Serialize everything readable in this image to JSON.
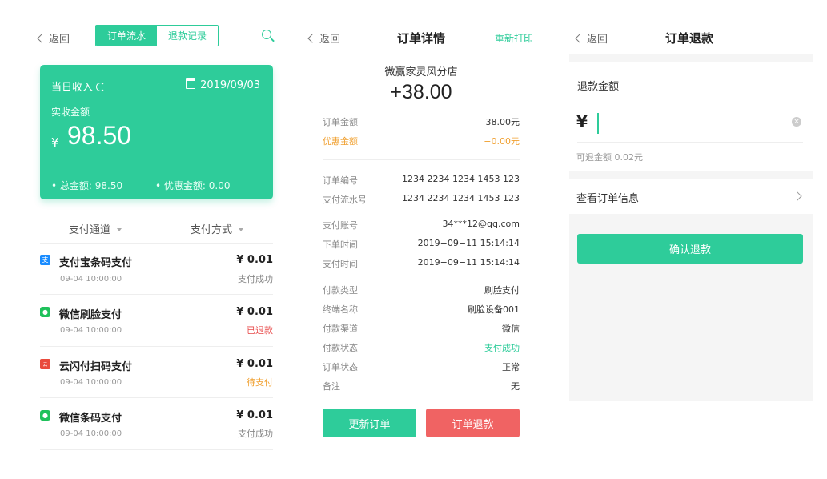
{
  "screen1": {
    "back_label": "返回",
    "tabs": [
      {
        "label": "订单流水",
        "active": true
      },
      {
        "label": "退款记录",
        "active": false
      }
    ],
    "card": {
      "title": "当日收入",
      "date": "2019/09/03",
      "amount_label": "实收金额",
      "currency": "¥",
      "amount": "98.50",
      "total_label": "• 总金额: 98.50",
      "discount_label": "• 优惠金额: 0.00"
    },
    "filters": [
      "支付通道",
      "支付方式"
    ],
    "rows": [
      {
        "name": "支付宝条码支付",
        "time": "09-04 10:00:00",
        "amount": "¥ 0.01",
        "status": "支付成功",
        "icon": "alipay-icon",
        "status_color": "#888888"
      },
      {
        "name": "微信刷脸支付",
        "time": "09-04 10:00:00",
        "amount": "¥ 0.01",
        "status": "已退款",
        "icon": "wechat-icon",
        "status_color": "#e84b4b"
      },
      {
        "name": "云闪付扫码支付",
        "time": "09-04 10:00:00",
        "amount": "¥ 0.01",
        "status": "待支付",
        "icon": "unionpay-icon",
        "status_color": "#f0a030"
      },
      {
        "name": "微信条码支付",
        "time": "09-04 10:00:00",
        "amount": "¥ 0.01",
        "status": "支付成功",
        "icon": "wechat-icon",
        "status_color": "#888888"
      }
    ]
  },
  "screen2": {
    "back_label": "返回",
    "title": "订单详情",
    "reprint_label": "重新打印",
    "store": "微赢家灵风分店",
    "amount": "+38.00",
    "fields": [
      {
        "k": "订单金额",
        "v": "38.00元"
      },
      {
        "k": "优惠金额",
        "v": "−0.00元",
        "highlight": true
      },
      {
        "k": "订单编号",
        "v": "1234 2234 1234 1453 123"
      },
      {
        "k": "支付流水号",
        "v": "1234 2234 1234 1453 123"
      },
      {
        "k": "支付账号",
        "v": "34***12@qq.com"
      },
      {
        "k": "下单时间",
        "v": "2019−09−11 15:14:14"
      },
      {
        "k": "支付时间",
        "v": "2019−09−11 15:14:14"
      },
      {
        "k": "付款类型",
        "v": "刷脸支付"
      },
      {
        "k": "终端名称",
        "v": "刷脸设备001"
      },
      {
        "k": "付款渠道",
        "v": "微信"
      },
      {
        "k": "付款状态",
        "v": "支付成功",
        "green": true
      },
      {
        "k": "订单状态",
        "v": "正常"
      },
      {
        "k": "备注",
        "v": "无"
      }
    ],
    "update_button": "更新订单",
    "refund_button": "订单退款"
  },
  "screen3": {
    "back_label": "返回",
    "title": "订单退款",
    "refund_amount_label": "退款金额",
    "currency": "¥",
    "input_value": "",
    "refundable": "可退金额 0.02元",
    "view_order": "查看订单信息",
    "confirm_button": "确认退款"
  },
  "colors": {
    "accent": "#2ecc9a",
    "danger": "#f06363",
    "warning": "#f0a030"
  }
}
